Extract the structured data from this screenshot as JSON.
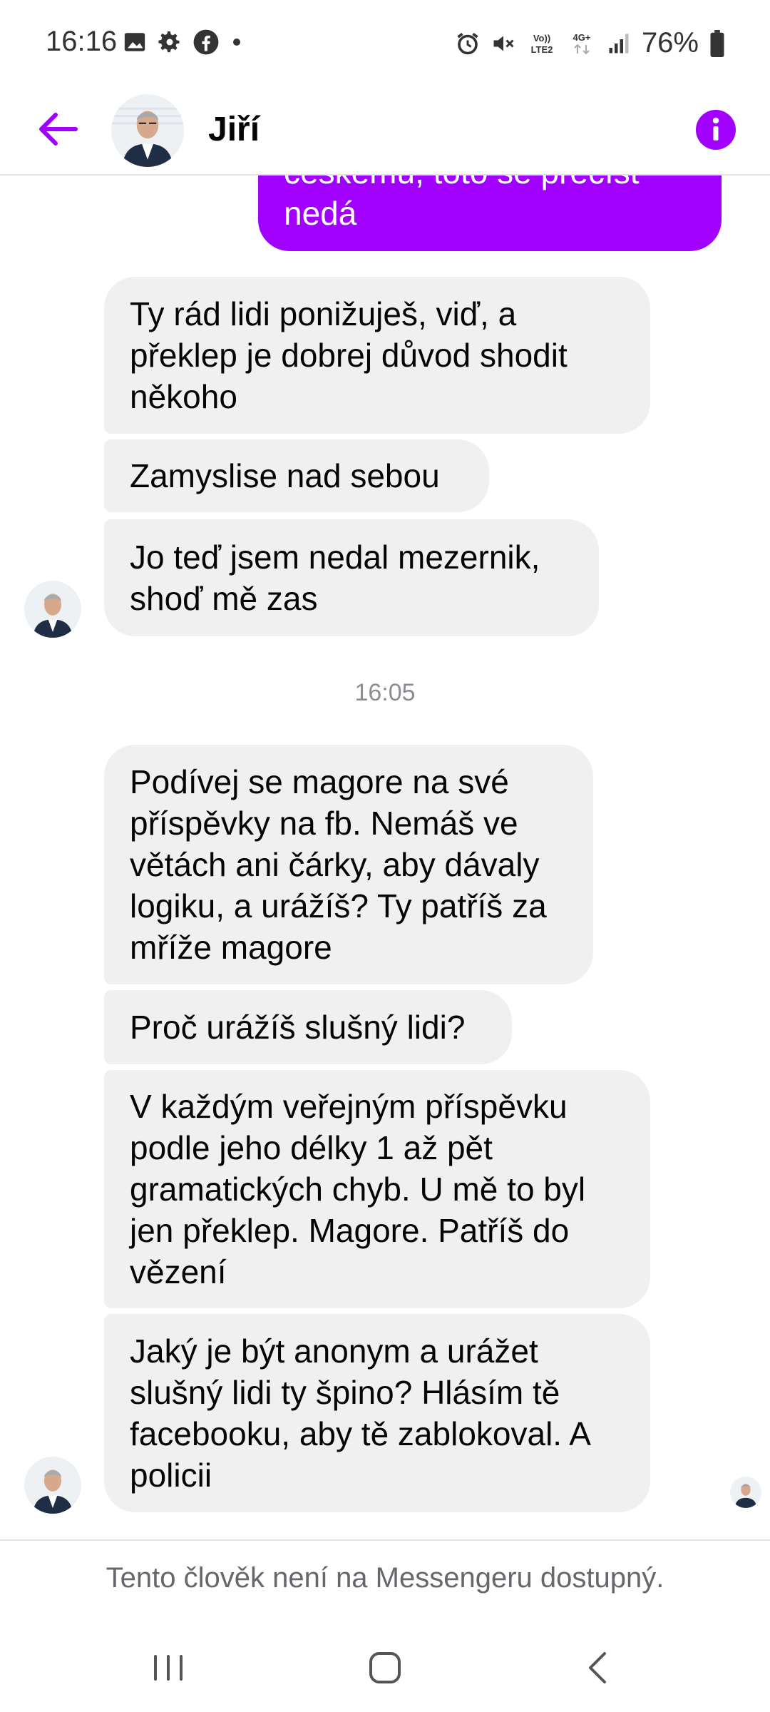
{
  "status_bar": {
    "time": "16:16",
    "battery": "76%",
    "network": "4G+",
    "volte": "Vo)) LTE2",
    "icons_left": [
      "image-icon",
      "gear-icon",
      "facebook-icon",
      "dot-icon"
    ],
    "icons_right": [
      "alarm-icon",
      "mute-icon",
      "volte-icon",
      "network-icon",
      "signal-icon",
      "battery-icon"
    ]
  },
  "header": {
    "contact_name": "Jiří",
    "accent_color": "#a100ff"
  },
  "messages": [
    {
      "side": "outgoing",
      "text": "českému, toto se přečíst nedá"
    },
    {
      "side": "incoming",
      "text": "Ty rád lidi ponižuješ, viď, a překlep je dobrej důvod shodit někoho"
    },
    {
      "side": "incoming",
      "text": "Zamyslise nad sebou"
    },
    {
      "side": "incoming",
      "text": "Jo teď jsem nedal mezernik, shoď mě zas"
    },
    {
      "side": "timestamp",
      "text": "16:05"
    },
    {
      "side": "incoming",
      "text": "Podívej se magore na své příspěvky na fb. Nemáš ve větách ani čárky, aby dávaly logiku, a urážíš? Ty patříš za mříže magore"
    },
    {
      "side": "incoming",
      "text": "Proč urážíš slušný lidi?"
    },
    {
      "side": "incoming",
      "text": "V každým veřejným příspěvku podle jeho délky 1 až pět gramatických chyb. U mě to byl jen překlep. Magore. Patříš do vězení"
    },
    {
      "side": "incoming",
      "text": "Jaký je být anonym a urážet slušný lidi ty špino? Hlásím tě facebooku, aby tě zablokoval. A policii"
    }
  ],
  "footer": {
    "notice": "Tento člověk není na Messengeru dostupný."
  },
  "nav": [
    "recent-apps-icon",
    "home-icon",
    "back-icon"
  ]
}
